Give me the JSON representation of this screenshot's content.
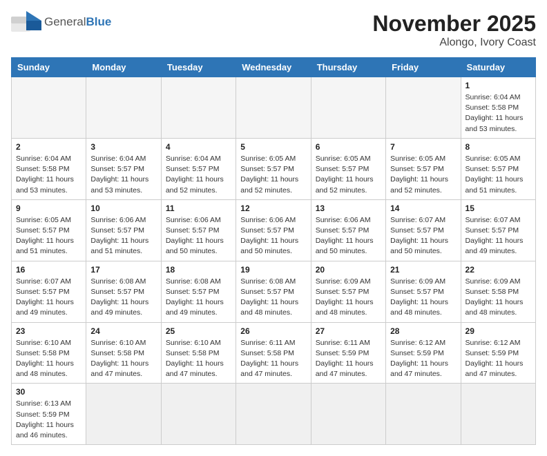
{
  "header": {
    "logo_general": "General",
    "logo_blue": "Blue",
    "title": "November 2025",
    "subtitle": "Alongo, Ivory Coast"
  },
  "days_of_week": [
    "Sunday",
    "Monday",
    "Tuesday",
    "Wednesday",
    "Thursday",
    "Friday",
    "Saturday"
  ],
  "weeks": [
    [
      {
        "day": "",
        "info": ""
      },
      {
        "day": "",
        "info": ""
      },
      {
        "day": "",
        "info": ""
      },
      {
        "day": "",
        "info": ""
      },
      {
        "day": "",
        "info": ""
      },
      {
        "day": "",
        "info": ""
      },
      {
        "day": "1",
        "info": "Sunrise: 6:04 AM\nSunset: 5:58 PM\nDaylight: 11 hours\nand 53 minutes."
      }
    ],
    [
      {
        "day": "2",
        "info": "Sunrise: 6:04 AM\nSunset: 5:58 PM\nDaylight: 11 hours\nand 53 minutes."
      },
      {
        "day": "3",
        "info": "Sunrise: 6:04 AM\nSunset: 5:57 PM\nDaylight: 11 hours\nand 53 minutes."
      },
      {
        "day": "4",
        "info": "Sunrise: 6:04 AM\nSunset: 5:57 PM\nDaylight: 11 hours\nand 52 minutes."
      },
      {
        "day": "5",
        "info": "Sunrise: 6:05 AM\nSunset: 5:57 PM\nDaylight: 11 hours\nand 52 minutes."
      },
      {
        "day": "6",
        "info": "Sunrise: 6:05 AM\nSunset: 5:57 PM\nDaylight: 11 hours\nand 52 minutes."
      },
      {
        "day": "7",
        "info": "Sunrise: 6:05 AM\nSunset: 5:57 PM\nDaylight: 11 hours\nand 52 minutes."
      },
      {
        "day": "8",
        "info": "Sunrise: 6:05 AM\nSunset: 5:57 PM\nDaylight: 11 hours\nand 51 minutes."
      }
    ],
    [
      {
        "day": "9",
        "info": "Sunrise: 6:05 AM\nSunset: 5:57 PM\nDaylight: 11 hours\nand 51 minutes."
      },
      {
        "day": "10",
        "info": "Sunrise: 6:06 AM\nSunset: 5:57 PM\nDaylight: 11 hours\nand 51 minutes."
      },
      {
        "day": "11",
        "info": "Sunrise: 6:06 AM\nSunset: 5:57 PM\nDaylight: 11 hours\nand 50 minutes."
      },
      {
        "day": "12",
        "info": "Sunrise: 6:06 AM\nSunset: 5:57 PM\nDaylight: 11 hours\nand 50 minutes."
      },
      {
        "day": "13",
        "info": "Sunrise: 6:06 AM\nSunset: 5:57 PM\nDaylight: 11 hours\nand 50 minutes."
      },
      {
        "day": "14",
        "info": "Sunrise: 6:07 AM\nSunset: 5:57 PM\nDaylight: 11 hours\nand 50 minutes."
      },
      {
        "day": "15",
        "info": "Sunrise: 6:07 AM\nSunset: 5:57 PM\nDaylight: 11 hours\nand 49 minutes."
      }
    ],
    [
      {
        "day": "16",
        "info": "Sunrise: 6:07 AM\nSunset: 5:57 PM\nDaylight: 11 hours\nand 49 minutes."
      },
      {
        "day": "17",
        "info": "Sunrise: 6:08 AM\nSunset: 5:57 PM\nDaylight: 11 hours\nand 49 minutes."
      },
      {
        "day": "18",
        "info": "Sunrise: 6:08 AM\nSunset: 5:57 PM\nDaylight: 11 hours\nand 49 minutes."
      },
      {
        "day": "19",
        "info": "Sunrise: 6:08 AM\nSunset: 5:57 PM\nDaylight: 11 hours\nand 48 minutes."
      },
      {
        "day": "20",
        "info": "Sunrise: 6:09 AM\nSunset: 5:57 PM\nDaylight: 11 hours\nand 48 minutes."
      },
      {
        "day": "21",
        "info": "Sunrise: 6:09 AM\nSunset: 5:57 PM\nDaylight: 11 hours\nand 48 minutes."
      },
      {
        "day": "22",
        "info": "Sunrise: 6:09 AM\nSunset: 5:58 PM\nDaylight: 11 hours\nand 48 minutes."
      }
    ],
    [
      {
        "day": "23",
        "info": "Sunrise: 6:10 AM\nSunset: 5:58 PM\nDaylight: 11 hours\nand 48 minutes."
      },
      {
        "day": "24",
        "info": "Sunrise: 6:10 AM\nSunset: 5:58 PM\nDaylight: 11 hours\nand 47 minutes."
      },
      {
        "day": "25",
        "info": "Sunrise: 6:10 AM\nSunset: 5:58 PM\nDaylight: 11 hours\nand 47 minutes."
      },
      {
        "day": "26",
        "info": "Sunrise: 6:11 AM\nSunset: 5:58 PM\nDaylight: 11 hours\nand 47 minutes."
      },
      {
        "day": "27",
        "info": "Sunrise: 6:11 AM\nSunset: 5:59 PM\nDaylight: 11 hours\nand 47 minutes."
      },
      {
        "day": "28",
        "info": "Sunrise: 6:12 AM\nSunset: 5:59 PM\nDaylight: 11 hours\nand 47 minutes."
      },
      {
        "day": "29",
        "info": "Sunrise: 6:12 AM\nSunset: 5:59 PM\nDaylight: 11 hours\nand 47 minutes."
      }
    ],
    [
      {
        "day": "30",
        "info": "Sunrise: 6:13 AM\nSunset: 5:59 PM\nDaylight: 11 hours\nand 46 minutes."
      },
      {
        "day": "",
        "info": ""
      },
      {
        "day": "",
        "info": ""
      },
      {
        "day": "",
        "info": ""
      },
      {
        "day": "",
        "info": ""
      },
      {
        "day": "",
        "info": ""
      },
      {
        "day": "",
        "info": ""
      }
    ]
  ]
}
